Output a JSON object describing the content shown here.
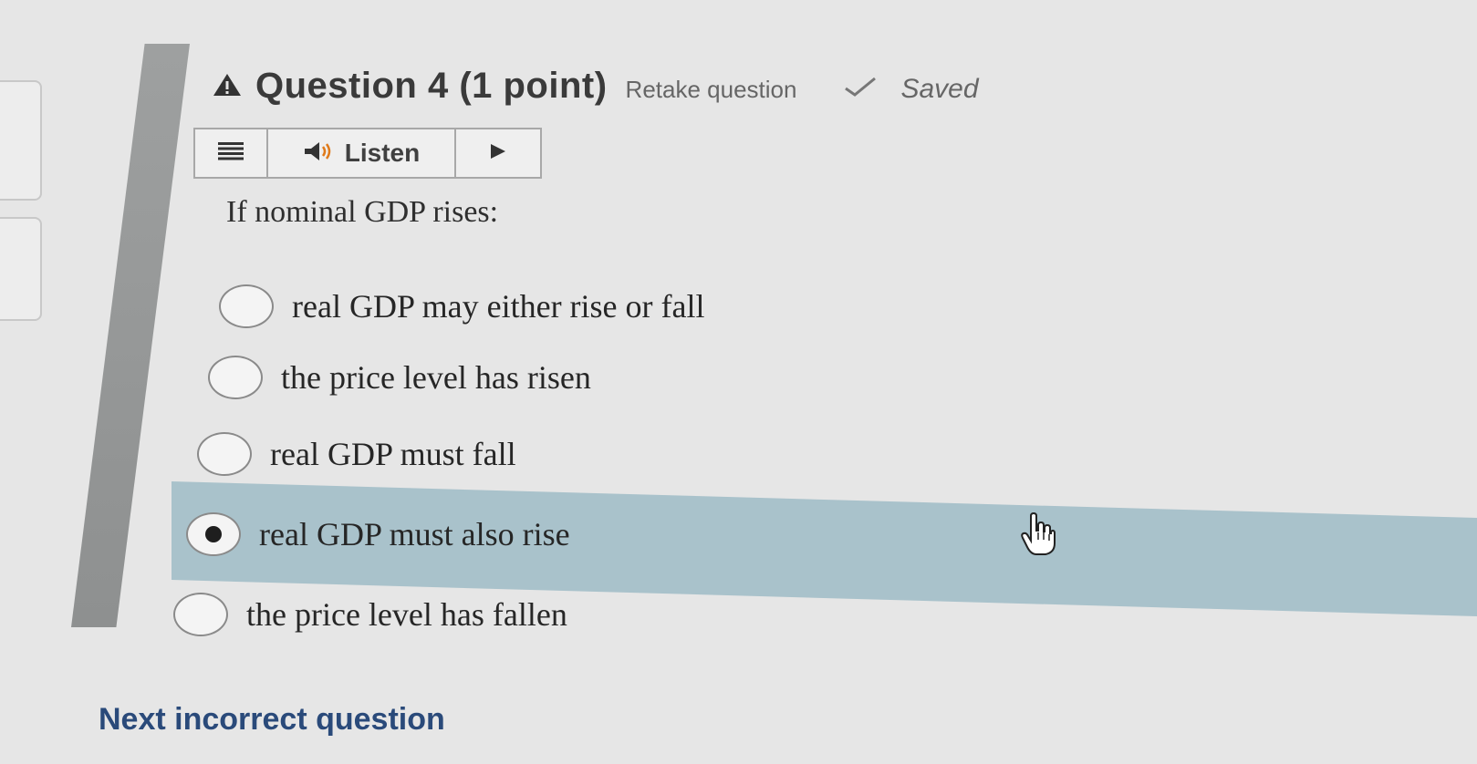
{
  "question": {
    "title": "Question 4 (1 point)",
    "retake_label": "Retake question",
    "status_label": "Saved",
    "prompt": "If nominal GDP rises:"
  },
  "toolbar": {
    "listen_label": "Listen"
  },
  "options": [
    {
      "label": "real GDP may either rise or fall",
      "selected": false
    },
    {
      "label": "the price level has risen",
      "selected": false
    },
    {
      "label": "real GDP must fall",
      "selected": false
    },
    {
      "label": "real GDP must also rise",
      "selected": true
    },
    {
      "label": "the price level has fallen",
      "selected": false
    }
  ],
  "footer": {
    "next_label": "Next incorrect question"
  },
  "icons": {
    "warning": "warning-icon",
    "check": "check-icon",
    "menu": "menu-icon",
    "speaker": "speaker-icon",
    "play": "play-icon",
    "cursor": "hand-cursor-icon"
  },
  "colors": {
    "selected_row": "#a9c2cb",
    "link": "#2a4a7a",
    "left_bar": "#9ea0a0"
  }
}
